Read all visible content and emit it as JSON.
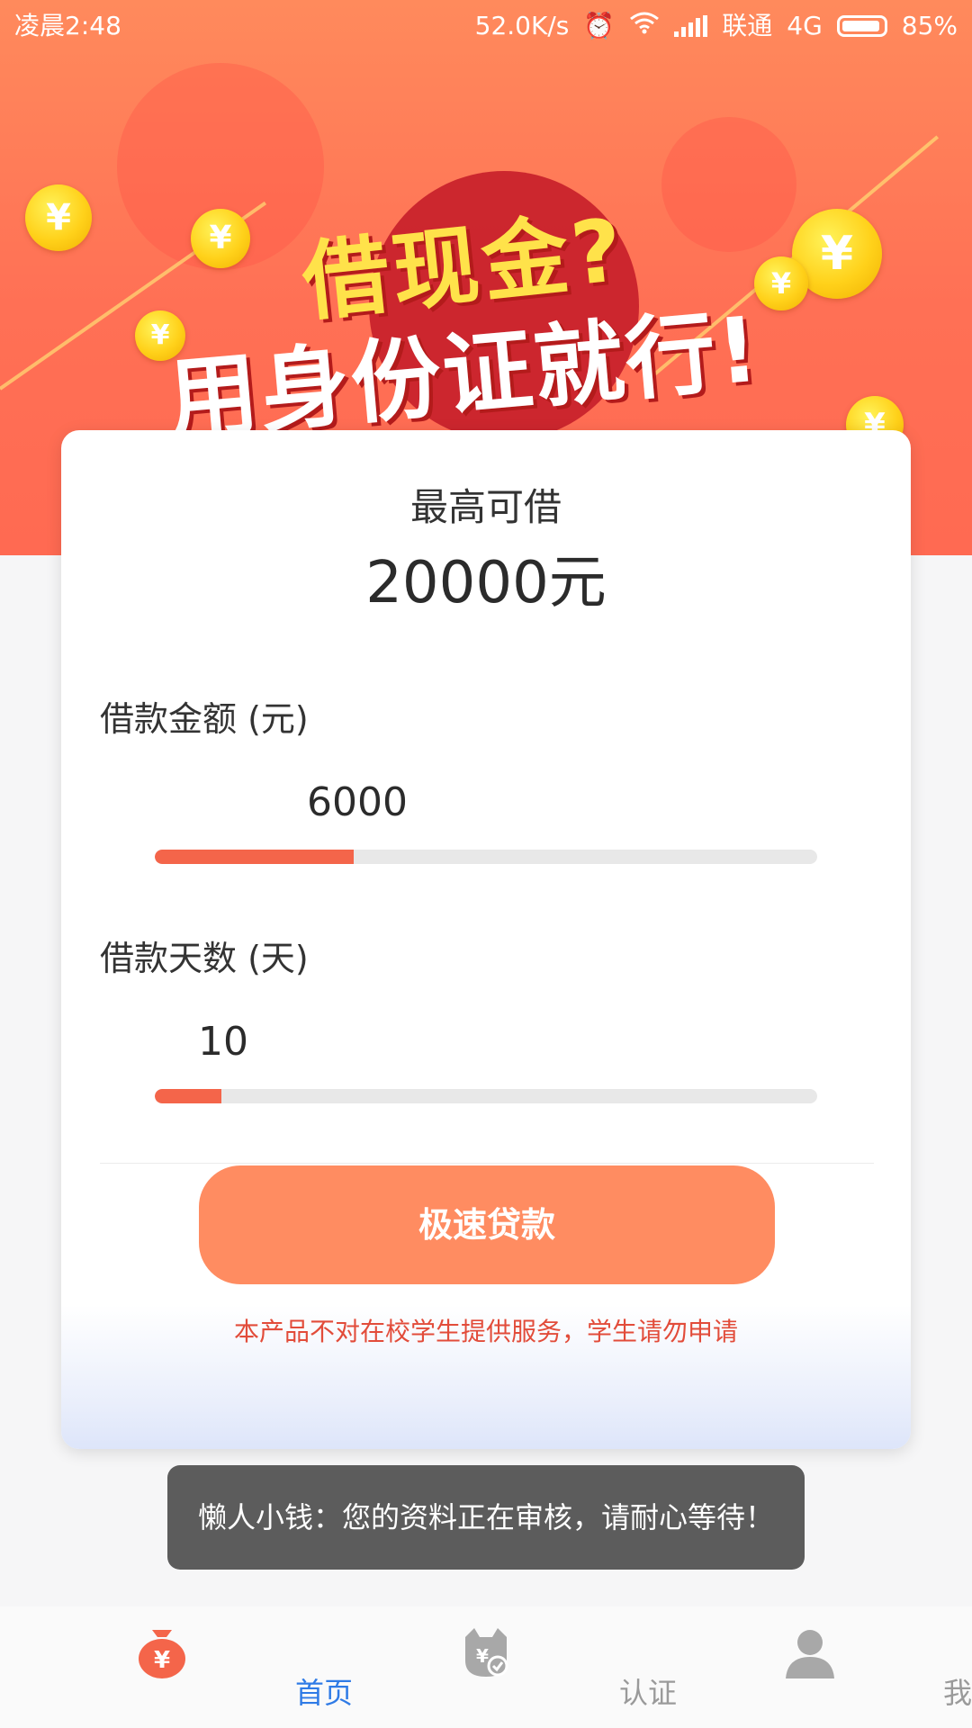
{
  "status_bar": {
    "time": "凌晨2:48",
    "network_speed": "52.0K/s",
    "carrier": "联通",
    "network_type": "4G",
    "battery": "85%",
    "battery_level": 0.85
  },
  "banner": {
    "headline": "借现金?",
    "subheadline": "用身份证就行!"
  },
  "card": {
    "max_label": "最高可借",
    "max_value": "20000元",
    "amount": {
      "label": "借款金额 (元)",
      "value": "6000",
      "fraction": 0.3
    },
    "days": {
      "label": "借款天数 (天)",
      "value": "10",
      "fraction": 0.1
    },
    "submit_label": "极速贷款",
    "notice": "本产品不对在校学生提供服务，学生请勿申请"
  },
  "toast": {
    "message": "懒人小钱：您的资料正在审核，请耐心等待！"
  },
  "bottom_nav": {
    "items": [
      {
        "label": "首页",
        "icon": "money-bag-icon",
        "active": true
      },
      {
        "label": "认证",
        "icon": "verify-icon",
        "active": false
      },
      {
        "label": "我的",
        "icon": "user-icon",
        "active": false
      }
    ]
  },
  "colors": {
    "accent": "#f4654a",
    "button": "#ff8c61",
    "notice": "#e24c3a",
    "nav_active": "#2f7be6",
    "nav_inactive": "#9a9a9a"
  }
}
